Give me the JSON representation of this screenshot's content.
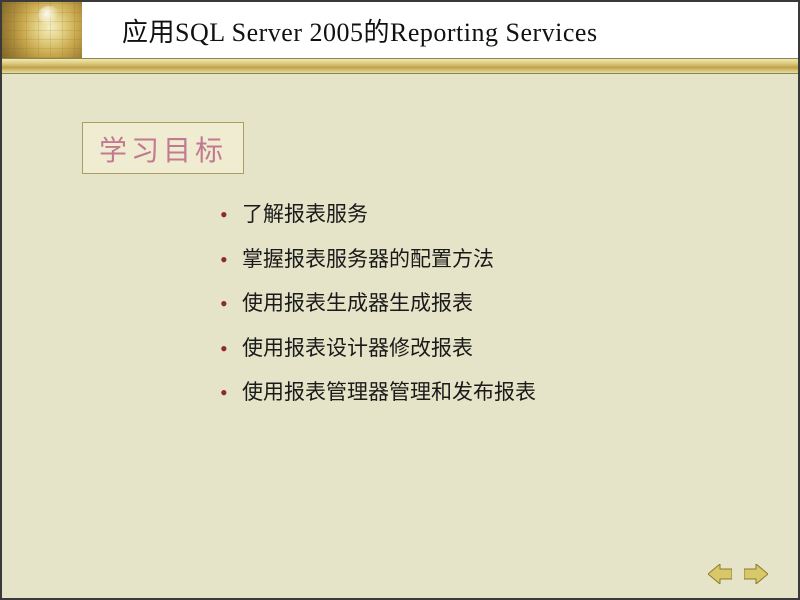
{
  "title": "应用SQL Server 2005的Reporting Services",
  "section_label": "学习目标",
  "bullets": [
    "了解报表服务",
    "掌握报表服务器的配置方法",
    "使用报表生成器生成报表",
    "使用报表设计器修改报表",
    "使用报表管理器管理和发布报表"
  ],
  "colors": {
    "slide_bg": "#e6e4c8",
    "bullet_marker": "#8b2b2b",
    "section_text": "#c17a90"
  }
}
